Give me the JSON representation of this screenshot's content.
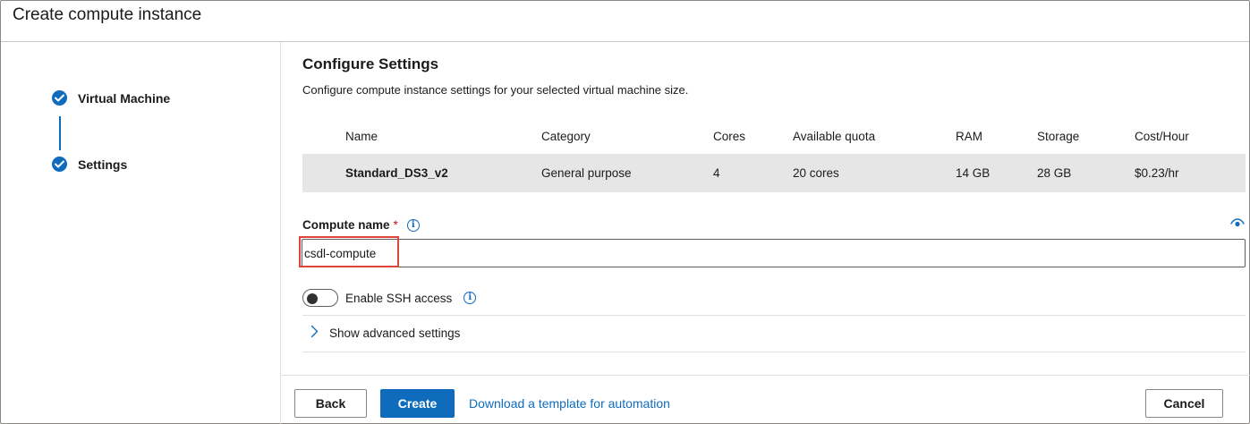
{
  "window": {
    "title": "Create compute instance"
  },
  "steps": [
    {
      "label": "Virtual Machine",
      "status": "complete"
    },
    {
      "label": "Settings",
      "status": "complete"
    }
  ],
  "section": {
    "title": "Configure Settings",
    "description": "Configure compute instance settings for your selected virtual machine size."
  },
  "vm_table": {
    "columns": [
      "Name",
      "Category",
      "Cores",
      "Available quota",
      "RAM",
      "Storage",
      "Cost/Hour"
    ],
    "rows": [
      [
        "Standard_DS3_v2",
        "General purpose",
        "4",
        "20 cores",
        "14 GB",
        "28 GB",
        "$0.23/hr"
      ]
    ]
  },
  "compute_name": {
    "label": "Compute name",
    "required_marker": "*",
    "value": "csdl-compute",
    "info_icon": "info-icon",
    "visibility_icon": "eye-icon"
  },
  "ssh": {
    "label": "Enable SSH access",
    "enabled": false,
    "info_icon": "info-icon"
  },
  "advanced": {
    "label": "Show advanced settings",
    "expanded": false
  },
  "footer": {
    "back_label": "Back",
    "create_label": "Create",
    "template_link": "Download a template for automation",
    "cancel_label": "Cancel"
  },
  "colors": {
    "accent": "#0f6cbd",
    "required": "#c50f1f",
    "highlight_box": "#e0453a",
    "selected_row": "#e6e6e6"
  }
}
